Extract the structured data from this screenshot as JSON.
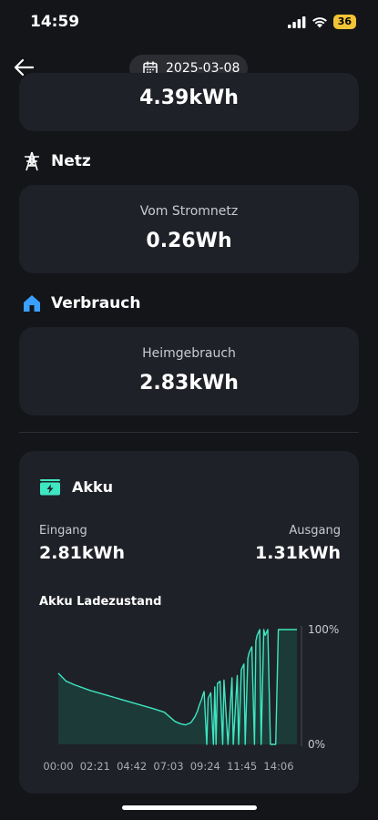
{
  "status": {
    "time": "14:59",
    "battery": "36"
  },
  "nav": {
    "date": "2025-03-08"
  },
  "top_card": {
    "value": "4.39kWh"
  },
  "netz": {
    "title": "Netz",
    "label": "Vom Stromnetz",
    "value": "0.26Wh"
  },
  "verbrauch": {
    "title": "Verbrauch",
    "label": "Heimgebrauch",
    "value": "2.83kWh"
  },
  "akku": {
    "title": "Akku",
    "eingang_label": "Eingang",
    "eingang_value": "2.81kWh",
    "ausgang_label": "Ausgang",
    "ausgang_value": "1.31kWh",
    "chart_title": "Akku Ladezustand"
  },
  "colors": {
    "accent": "#3ee6c1",
    "fill": "#1c3a37",
    "card": "#1f2128",
    "background": "#141519",
    "house": "#3aa0ff"
  },
  "chart_data": {
    "type": "area",
    "title": "Akku Ladezustand",
    "x_tick_labels": [
      "00:00",
      "02:21",
      "04:42",
      "07:03",
      "09:24",
      "11:45",
      "14:06"
    ],
    "y_tick_labels": [
      "100%",
      "0%"
    ],
    "ylim": [
      0,
      100
    ],
    "x_unit": "minutes since 00:00",
    "series": [
      {
        "x": [
          0,
          30,
          60,
          120,
          180,
          240,
          300,
          360,
          400,
          420,
          440,
          460,
          480,
          500,
          515,
          525,
          530,
          535,
          540,
          545,
          550,
          560,
          565,
          575,
          585,
          590,
          595,
          600,
          610,
          620,
          625,
          640,
          655,
          660,
          675,
          680,
          690,
          700,
          705,
          715,
          720,
          730,
          740,
          745,
          750,
          760,
          765,
          775,
          780,
          790,
          800,
          810,
          820,
          830,
          835,
          840,
          850,
          860,
          870,
          880,
          890,
          900
        ],
        "y": [
          62,
          55,
          52,
          47,
          43,
          39,
          35,
          31,
          28,
          24,
          20,
          18,
          17,
          19,
          24,
          29,
          33,
          36,
          39,
          43,
          46,
          0,
          40,
          45,
          0,
          50,
          0,
          53,
          55,
          0,
          56,
          0,
          58,
          0,
          60,
          0,
          65,
          70,
          0,
          75,
          80,
          85,
          0,
          90,
          95,
          100,
          0,
          100,
          95,
          100,
          0,
          0,
          0,
          100,
          100,
          100,
          100,
          100,
          100,
          100,
          100,
          100
        ]
      }
    ]
  }
}
